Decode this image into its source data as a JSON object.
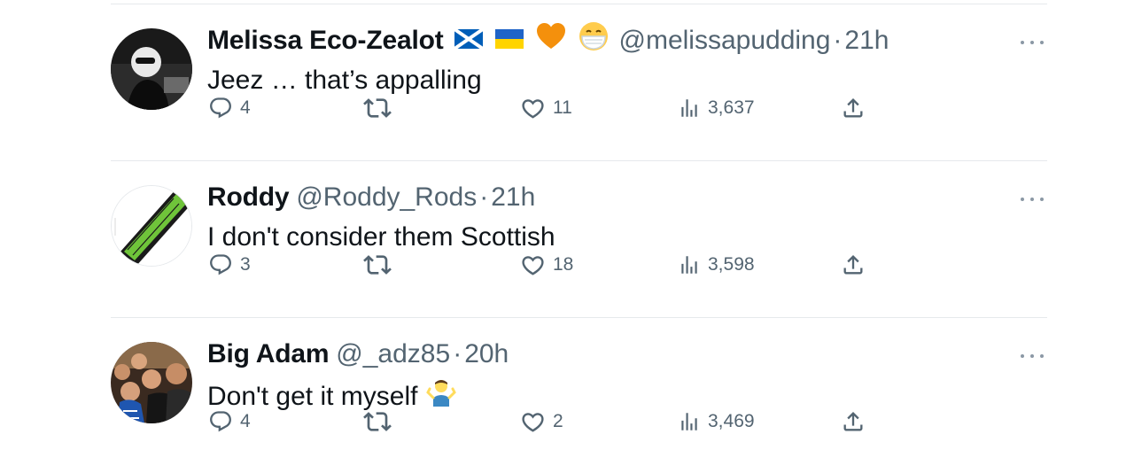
{
  "tweets": [
    {
      "name": "Melissa Eco-Zealot",
      "badges": [
        "scotland-flag",
        "ukraine-flag",
        "orange-heart",
        "face-with-mask"
      ],
      "handle": "@melissapudding",
      "dot": "·",
      "time": "21h",
      "text": "Jeez … that’s appalling",
      "replies": "4",
      "retweets": "",
      "likes": "11",
      "views": "3,637"
    },
    {
      "name": "Roddy",
      "badges": [],
      "handle": "@Roddy_Rods",
      "dot": "·",
      "time": "21h",
      "text": "I don't consider them Scottish",
      "replies": "3",
      "retweets": "",
      "likes": "18",
      "views": "3,598"
    },
    {
      "name": "Big Adam",
      "badges": [],
      "handle": "@_adz85",
      "dot": "·",
      "time": "20h",
      "text": "Don't get it myself",
      "text_emoji": "man-shrugging",
      "replies": "4",
      "retweets": "",
      "likes": "2",
      "views": "3,469"
    }
  ],
  "colors": {
    "text": "#0f1419",
    "secondary": "#536471",
    "divider": "#e6e9ec"
  }
}
